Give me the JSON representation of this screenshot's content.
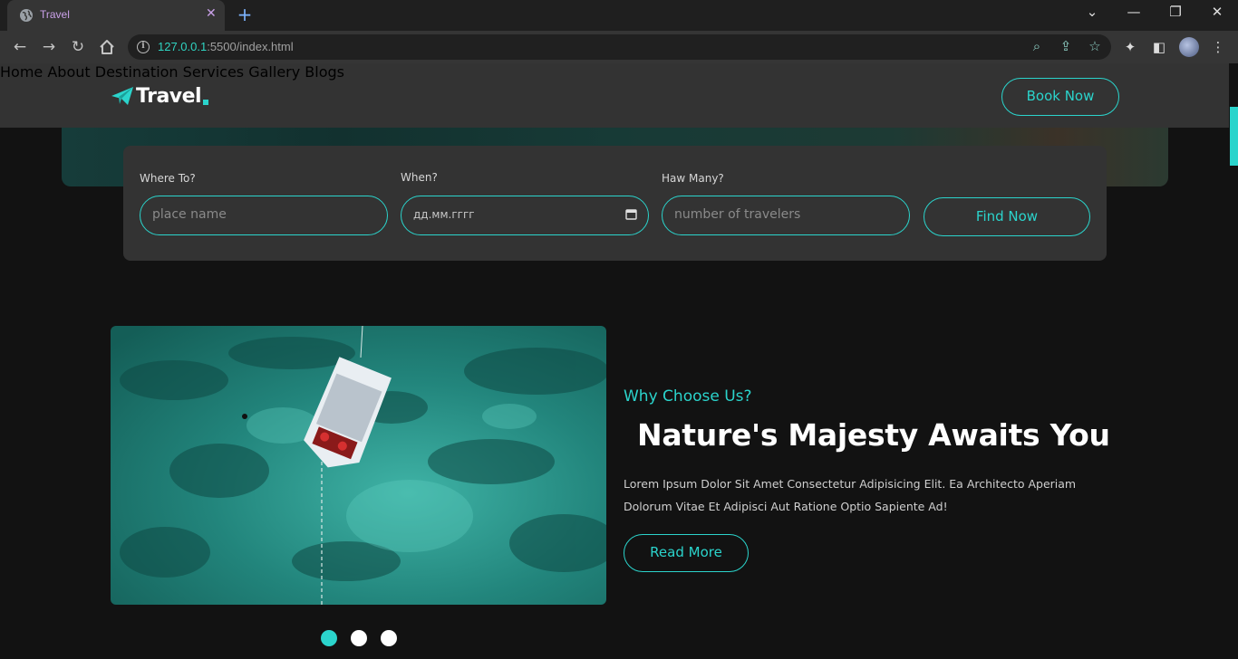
{
  "browser": {
    "tab_title": "Travel",
    "url_host": "127.0.0.1",
    "url_rest": ":5500/index.html"
  },
  "header": {
    "logo_text": "Travel",
    "nav": [
      "Home",
      "About",
      "Destination",
      "Services",
      "Gallery",
      "Blogs"
    ],
    "cta": "Book Now"
  },
  "booking": {
    "where_label": "Where To?",
    "where_placeholder": "place name",
    "when_label": "When?",
    "when_value": "дд.мм.гггг",
    "many_label": "Haw Many?",
    "many_placeholder": "number of travelers",
    "submit": "Find Now"
  },
  "about": {
    "subtitle": "Why Choose Us?",
    "headline": "Nature's Majesty Awaits You",
    "text": "Lorem Ipsum Dolor Sit Amet Consectetur Adipisicing Elit. Ea Architecto Aperiam Dolorum Vitae Et Adipisci Aut Ratione Optio Sapiente Ad!",
    "button": "Read More"
  },
  "slider": {
    "count": 3,
    "active": 1
  },
  "colors": {
    "accent": "#2bd4cc",
    "header_bg": "#333333",
    "page_bg": "#121212"
  }
}
